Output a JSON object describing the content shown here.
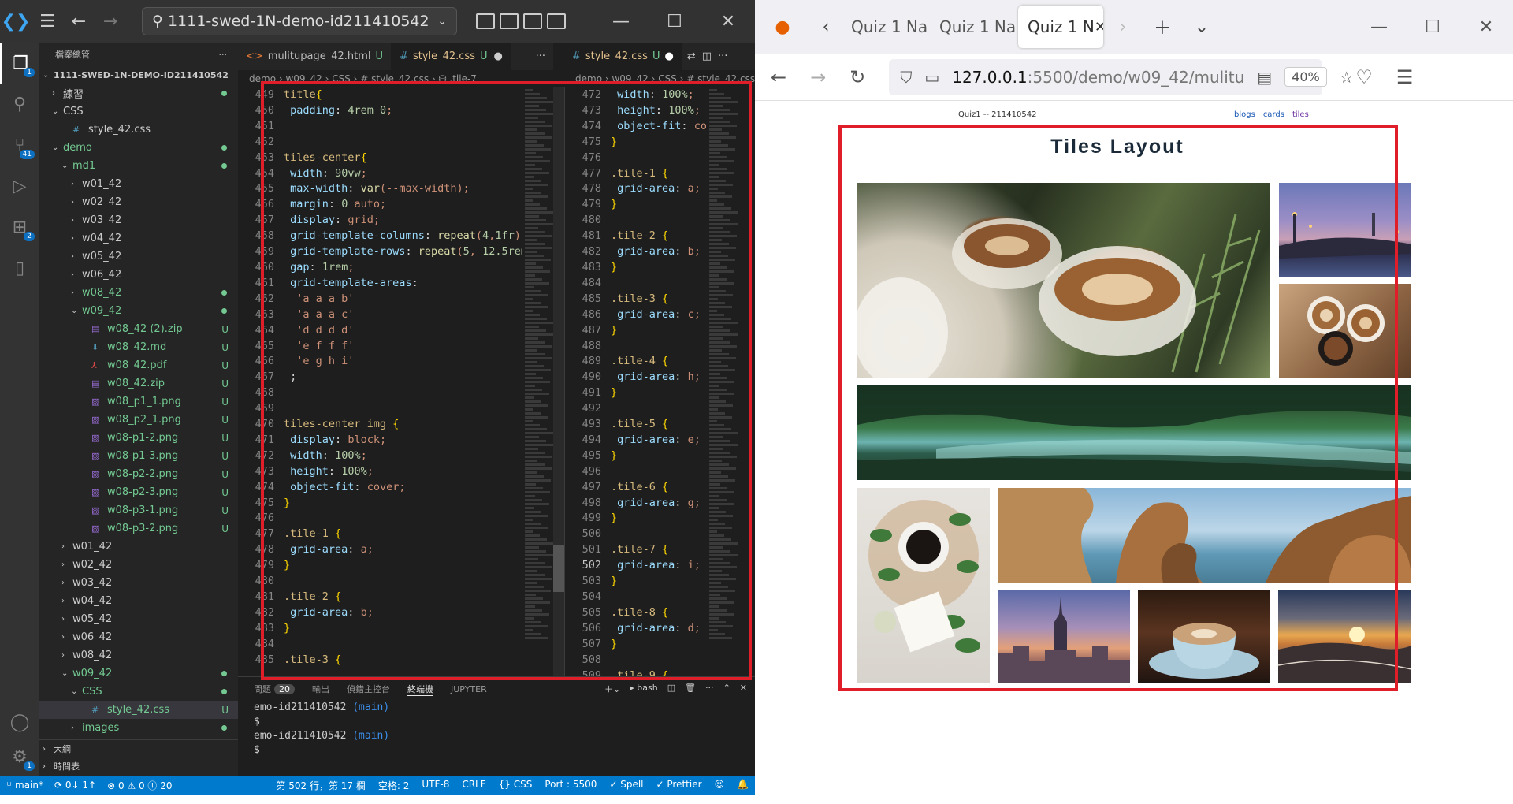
{
  "vscode": {
    "search_text": "1111-swed-1N-demo-id211410542",
    "activity_badges": {
      "explorer": "1",
      "scm": "41",
      "extensions": "2",
      "accounts": "1"
    },
    "explorer_title": "檔案總管",
    "tree": [
      {
        "label": "1111-SWED-1N-DEMO-ID211410542",
        "indent": 0,
        "arrow": "⌄",
        "type": "root"
      },
      {
        "label": "練習",
        "indent": 1,
        "arrow": "›",
        "type": "folder",
        "dot": true
      },
      {
        "label": "CSS",
        "indent": 1,
        "arrow": "⌄",
        "type": "folder"
      },
      {
        "label": "style_42.css",
        "indent": 2,
        "arrow": "",
        "type": "css"
      },
      {
        "label": "demo",
        "indent": 1,
        "arrow": "⌄",
        "type": "folder",
        "green": true,
        "dot": true
      },
      {
        "label": "md1",
        "indent": 2,
        "arrow": "⌄",
        "type": "folder",
        "green": true,
        "dot": true
      },
      {
        "label": "w01_42",
        "indent": 3,
        "arrow": "›",
        "type": "folder"
      },
      {
        "label": "w02_42",
        "indent": 3,
        "arrow": "›",
        "type": "folder"
      },
      {
        "label": "w03_42",
        "indent": 3,
        "arrow": "›",
        "type": "folder"
      },
      {
        "label": "w04_42",
        "indent": 3,
        "arrow": "›",
        "type": "folder"
      },
      {
        "label": "w05_42",
        "indent": 3,
        "arrow": "›",
        "type": "folder"
      },
      {
        "label": "w06_42",
        "indent": 3,
        "arrow": "›",
        "type": "folder"
      },
      {
        "label": "w08_42",
        "indent": 3,
        "arrow": "›",
        "type": "folder",
        "green": true,
        "dot": true
      },
      {
        "label": "w09_42",
        "indent": 3,
        "arrow": "⌄",
        "type": "folder",
        "green": true,
        "dot": true
      },
      {
        "label": "w08_42 (2).zip",
        "indent": 4,
        "arrow": "",
        "type": "zip",
        "green": true,
        "u": "U"
      },
      {
        "label": "w08_42.md",
        "indent": 4,
        "arrow": "",
        "type": "md",
        "green": true,
        "u": "U"
      },
      {
        "label": "w08_42.pdf",
        "indent": 4,
        "arrow": "",
        "type": "pdf",
        "green": true,
        "u": "U"
      },
      {
        "label": "w08_42.zip",
        "indent": 4,
        "arrow": "",
        "type": "zip",
        "green": true,
        "u": "U"
      },
      {
        "label": "w08_p1_1.png",
        "indent": 4,
        "arrow": "",
        "type": "png",
        "green": true,
        "u": "U"
      },
      {
        "label": "w08_p2_1.png",
        "indent": 4,
        "arrow": "",
        "type": "png",
        "green": true,
        "u": "U"
      },
      {
        "label": "w08-p1-2.png",
        "indent": 4,
        "arrow": "",
        "type": "png",
        "green": true,
        "u": "U"
      },
      {
        "label": "w08-p1-3.png",
        "indent": 4,
        "arrow": "",
        "type": "png",
        "green": true,
        "u": "U"
      },
      {
        "label": "w08-p2-2.png",
        "indent": 4,
        "arrow": "",
        "type": "png",
        "green": true,
        "u": "U"
      },
      {
        "label": "w08-p2-3.png",
        "indent": 4,
        "arrow": "",
        "type": "png",
        "green": true,
        "u": "U"
      },
      {
        "label": "w08-p3-1.png",
        "indent": 4,
        "arrow": "",
        "type": "png",
        "green": true,
        "u": "U"
      },
      {
        "label": "w08-p3-2.png",
        "indent": 4,
        "arrow": "",
        "type": "png",
        "green": true,
        "u": "U"
      },
      {
        "label": "w01_42",
        "indent": 2,
        "arrow": "›",
        "type": "folder"
      },
      {
        "label": "w02_42",
        "indent": 2,
        "arrow": "›",
        "type": "folder"
      },
      {
        "label": "w03_42",
        "indent": 2,
        "arrow": "›",
        "type": "folder"
      },
      {
        "label": "w04_42",
        "indent": 2,
        "arrow": "›",
        "type": "folder"
      },
      {
        "label": "w05_42",
        "indent": 2,
        "arrow": "›",
        "type": "folder"
      },
      {
        "label": "w06_42",
        "indent": 2,
        "arrow": "›",
        "type": "folder"
      },
      {
        "label": "w08_42",
        "indent": 2,
        "arrow": "›",
        "type": "folder"
      },
      {
        "label": "w09_42",
        "indent": 2,
        "arrow": "⌄",
        "type": "folder",
        "green": true,
        "dot": true
      },
      {
        "label": "CSS",
        "indent": 3,
        "arrow": "⌄",
        "type": "folder",
        "green": true,
        "dot": true
      },
      {
        "label": "style_42.css",
        "indent": 4,
        "arrow": "",
        "type": "css",
        "green": true,
        "u": "U",
        "sel": true
      },
      {
        "label": "images",
        "indent": 3,
        "arrow": "›",
        "type": "folder",
        "green": true,
        "dot": true
      }
    ],
    "outline_label": "大綱",
    "timeline_label": "時間表",
    "tabs": {
      "left": [
        {
          "label": "mulitupage_42.html",
          "u": "U",
          "icon": "<>"
        },
        {
          "label": "style_42.css",
          "u": "U",
          "icon": "#",
          "active": true
        }
      ],
      "right": [
        {
          "label": "style_42.css",
          "u": "U",
          "icon": "#",
          "active": true
        }
      ]
    },
    "breadcrumb_left": "demo › w09_42 › CSS › # style_42.css › ⛁ .tile-7",
    "breadcrumb_right": "demo › w09_42 › CSS › # style_42.css",
    "left_start_line": 449,
    "left_code": [
      "title{",
      " padding: 4rem 0;",
      "",
      "",
      "tiles-center{",
      " width: 90vw;",
      " max-width: var(--max-width);",
      " margin: 0 auto;",
      " display: grid;",
      " grid-template-columns: repeat(4,1fr);",
      " grid-template-rows: repeat(5, 12.5rem);",
      " gap: 1rem;",
      " grid-template-areas:",
      "  'a a a b'",
      "  'a a a c'",
      "  'd d d d'",
      "  'e f f f'",
      "  'e g h i'",
      " ;",
      "",
      "",
      "tiles-center img {",
      " display: block;",
      " width: 100%;",
      " height: 100%;",
      " object-fit: cover;",
      "}",
      "",
      ".tile-1 {",
      " grid-area: a;",
      "}",
      "",
      ".tile-2 {",
      " grid-area: b;",
      "}",
      "",
      ".tile-3 {"
    ],
    "right_start_line": 472,
    "right_code": [
      " width: 100%;",
      " height: 100%;",
      " object-fit: cover;",
      "}",
      "",
      ".tile-1 {",
      " grid-area: a;",
      "}",
      "",
      ".tile-2 {",
      " grid-area: b;",
      "}",
      "",
      ".tile-3 {",
      " grid-area: c;",
      "}",
      "",
      ".tile-4 {",
      " grid-area: h;",
      "}",
      "",
      ".tile-5 {",
      " grid-area: e;",
      "}",
      "",
      ".tile-6 {",
      " grid-area: g;",
      "}",
      "",
      ".tile-7 {",
      " grid-area: i;",
      "}",
      "",
      ".tile-8 {",
      " grid-area: d;",
      "}",
      "",
      ".tile-9 {"
    ],
    "right_current_line": 502,
    "panel": {
      "problems": "問題",
      "problems_count": "20",
      "output": "輸出",
      "debug": "偵錯主控台",
      "terminal": "終端機",
      "jupyter": "JUPYTER",
      "shell": "bash"
    },
    "terminal_lines": [
      {
        "prefix": "emo-id211410542 ",
        "branch": "(main)"
      },
      {
        "prefix": "$",
        "branch": ""
      },
      {
        "prefix": "emo-id211410542 ",
        "branch": "(main)"
      },
      {
        "prefix": "$",
        "branch": ""
      }
    ],
    "status": {
      "branch": "main*",
      "sync": "0↓ 1↑",
      "problems": "⊗ 0 ⚠ 0 ⓘ 20",
      "position": "第 502 行，第 17 欄",
      "spaces": "空格: 2",
      "encoding": "UTF-8",
      "eol": "CRLF",
      "lang": "{} CSS",
      "port": "Port : 5500",
      "spell": "✓ Spell",
      "prettier": "✓ Prettier"
    }
  },
  "firefox": {
    "tabs": [
      {
        "label": "Quiz 1 Na"
      },
      {
        "label": "Quiz 1 Na"
      },
      {
        "label": "Quiz 1 N",
        "active": true
      }
    ],
    "url_host": "127.0.0.1",
    "url_path": ":5500/demo/w09_42/mulitu",
    "zoom": "40%",
    "page": {
      "brand": "Quiz1 -- 211410542",
      "links": [
        "blogs",
        "cards",
        "tiles"
      ],
      "title": "Tiles Layout"
    }
  }
}
